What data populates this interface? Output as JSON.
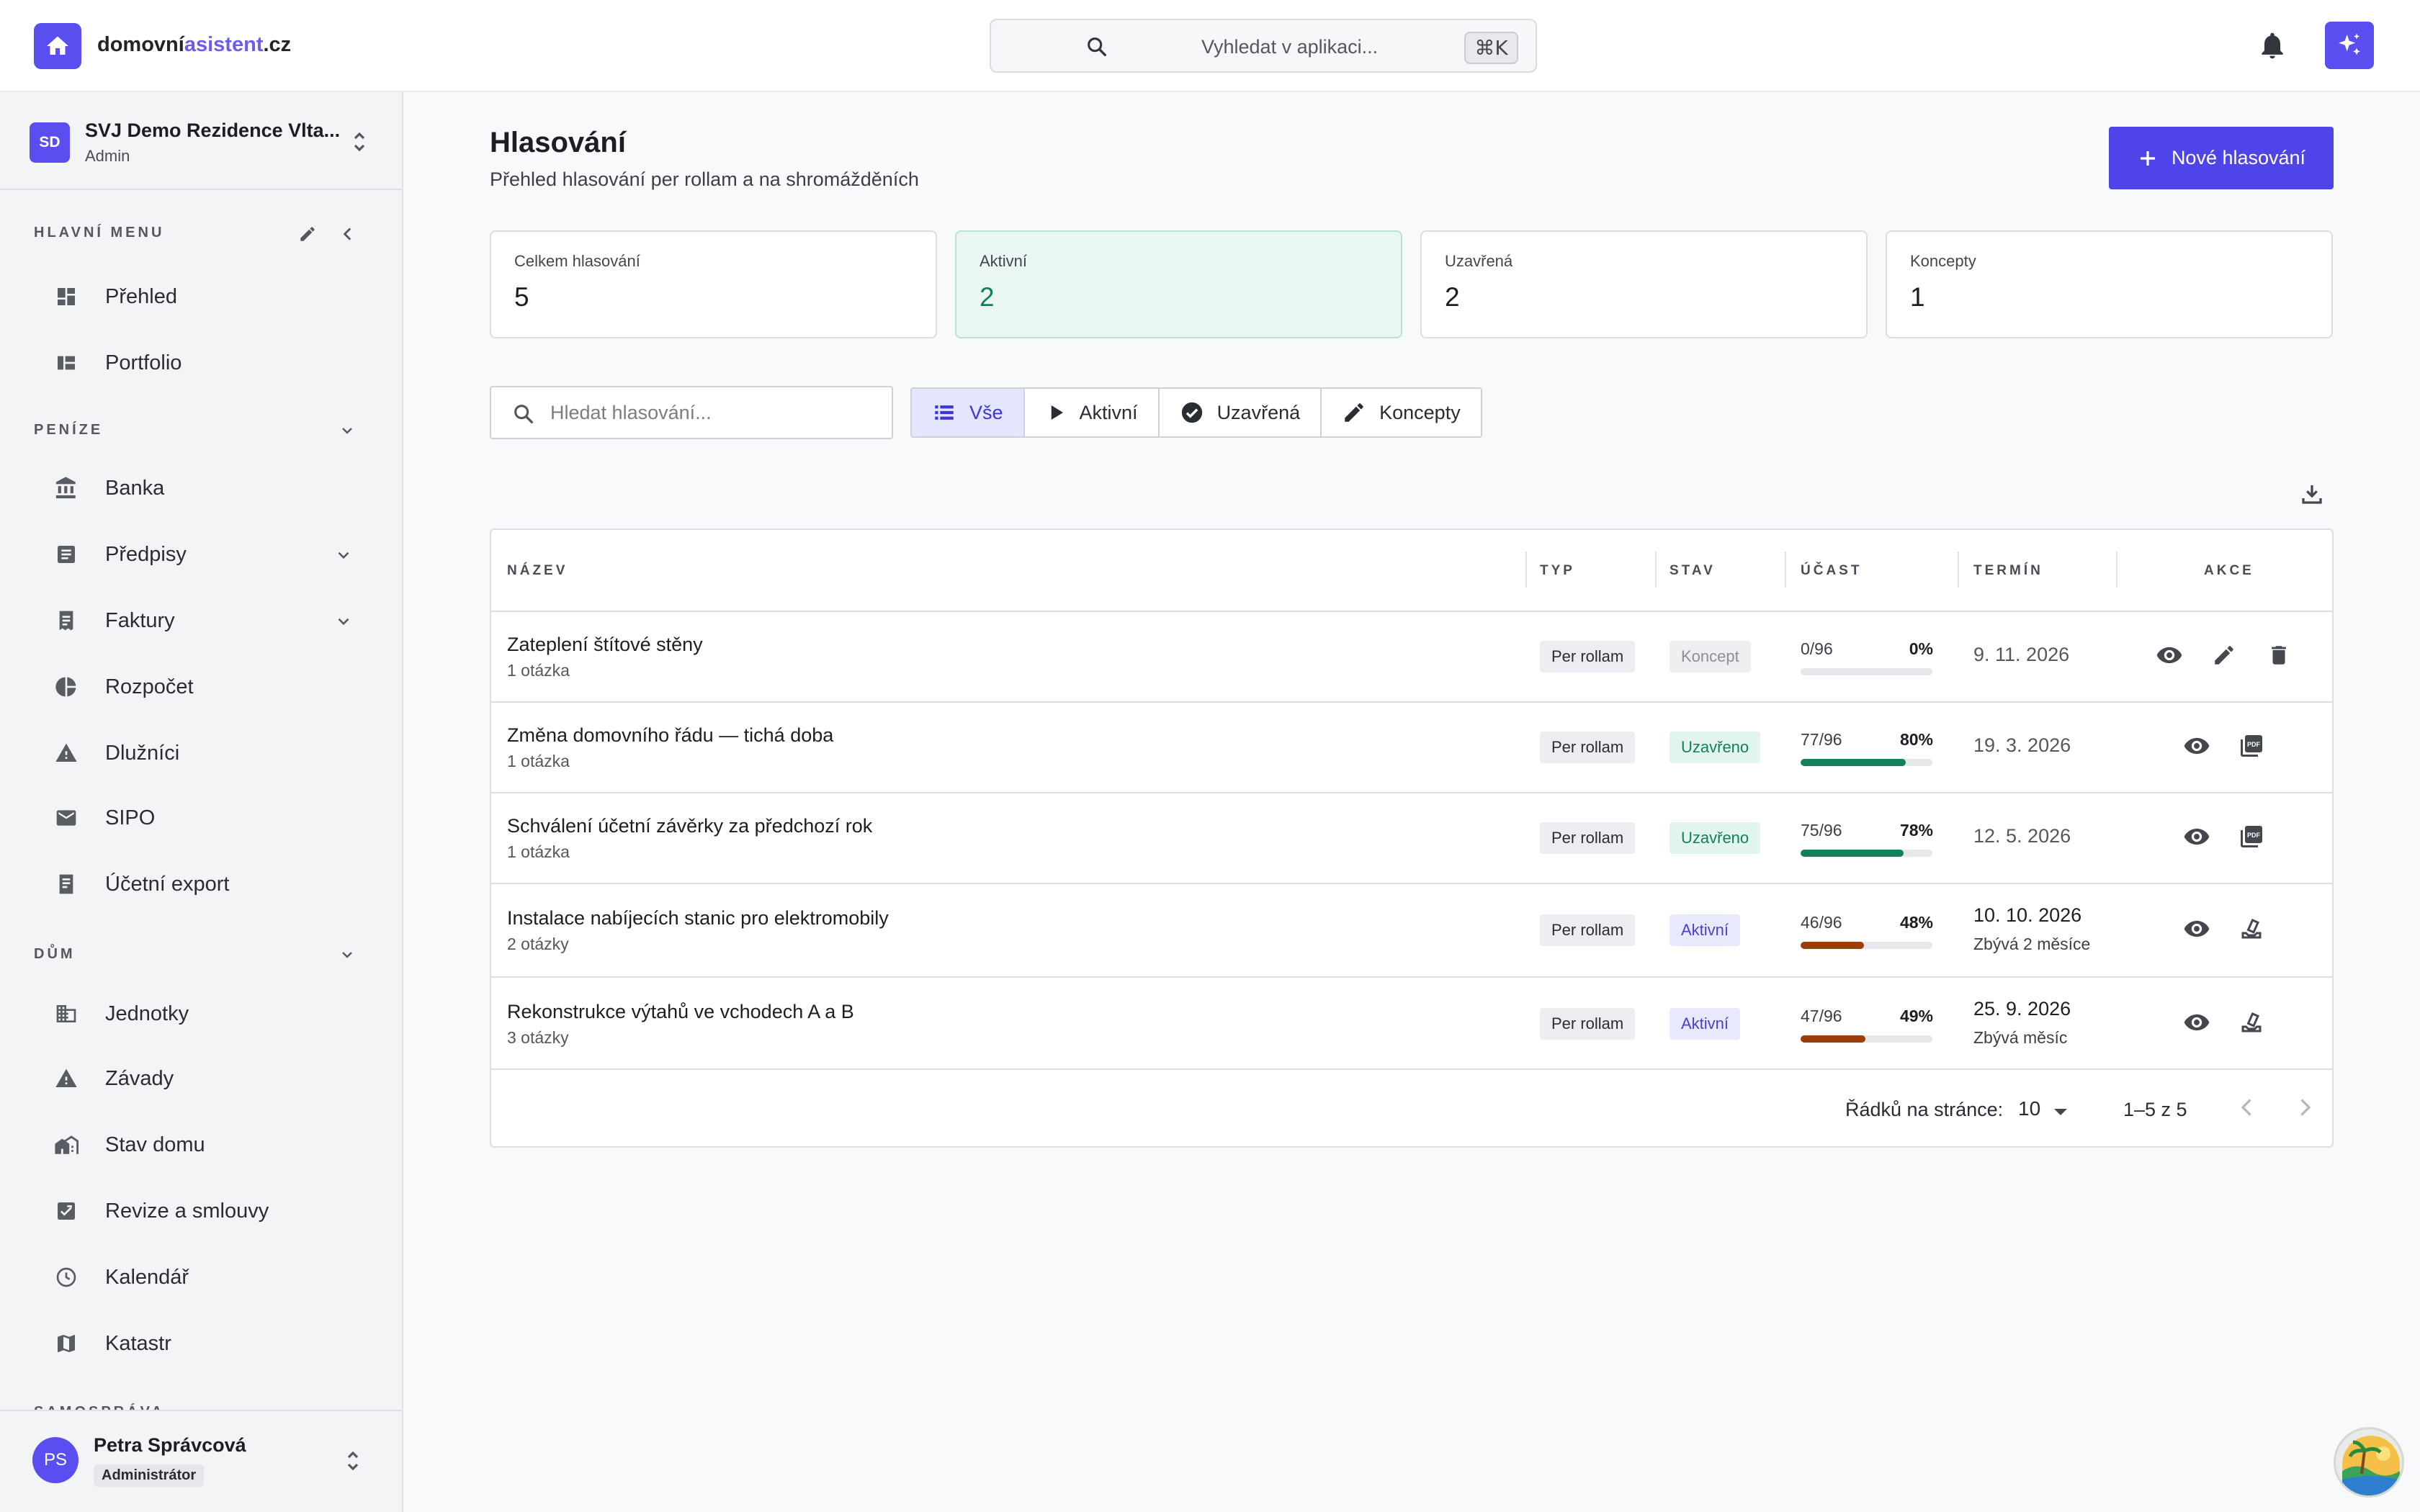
{
  "brand": {
    "prefix": "domovní",
    "accent": "asistent",
    "suffix": ".cz"
  },
  "topbar": {
    "search_placeholder": "Vyhledat v aplikaci...",
    "shortcut": "⌘K"
  },
  "org": {
    "initials": "SD",
    "name": "SVJ Demo Rezidence Vlta...",
    "role": "Admin"
  },
  "sidebar": {
    "main_label": "HLAVNÍ MENU",
    "main_items": [
      {
        "label": "Přehled",
        "icon": "dashboard-icon"
      },
      {
        "label": "Portfolio",
        "icon": "portfolio-icon"
      }
    ],
    "money_label": "PENÍZE",
    "money_items": [
      {
        "label": "Banka",
        "icon": "bank-icon"
      },
      {
        "label": "Předpisy",
        "icon": "prescriptions-icon"
      },
      {
        "label": "Faktury",
        "icon": "invoice-icon"
      },
      {
        "label": "Rozpočet",
        "icon": "pie-chart-icon"
      },
      {
        "label": "Dlužníci",
        "icon": "warning-icon"
      },
      {
        "label": "SIPO",
        "icon": "mail-icon"
      },
      {
        "label": "Účetní export",
        "icon": "export-icon"
      }
    ],
    "house_label": "DŮM",
    "house_items": [
      {
        "label": "Jednotky",
        "icon": "building-icon"
      },
      {
        "label": "Závady",
        "icon": "warning-icon"
      },
      {
        "label": "Stav domu",
        "icon": "house-state-icon"
      },
      {
        "label": "Revize a smlouvy",
        "icon": "checklist-icon"
      },
      {
        "label": "Kalendář",
        "icon": "clock-icon"
      },
      {
        "label": "Katastr",
        "icon": "map-icon"
      }
    ],
    "next_label": "SAMOSPRÁVA"
  },
  "user": {
    "initials": "PS",
    "name": "Petra Správcová",
    "role": "Administrátor"
  },
  "page": {
    "title": "Hlasování",
    "subtitle": "Přehled hlasování per rollam a na shromážděních",
    "new_button": "Nové hlasování"
  },
  "stats": [
    {
      "label": "Celkem hlasování",
      "value": "5"
    },
    {
      "label": "Aktivní",
      "value": "2"
    },
    {
      "label": "Uzavřená",
      "value": "2"
    },
    {
      "label": "Koncepty",
      "value": "1"
    }
  ],
  "filter": {
    "placeholder": "Hledat hlasování...",
    "tabs": [
      "Vše",
      "Aktivní",
      "Uzavřená",
      "Koncepty"
    ],
    "selected": "Vše"
  },
  "table": {
    "headers": [
      "NÁZEV",
      "TYP",
      "STAV",
      "ÚČAST",
      "TERMÍN",
      "AKCE"
    ],
    "rows": [
      {
        "name": "Zateplení štítové stěny",
        "questions": "1 otázka",
        "type": "Per rollam",
        "state": "Koncept",
        "state_kind": "draft",
        "participation": "0/96",
        "pct": "0%",
        "fraction": 0.0,
        "color": "#12805c",
        "term": "9. 11. 2026",
        "term_note": "",
        "actions": [
          "view-icon",
          "edit-icon",
          "delete-icon"
        ]
      },
      {
        "name": "Změna domovního řádu — tichá doba",
        "questions": "1 otázka",
        "type": "Per rollam",
        "state": "Uzavřeno",
        "state_kind": "closed",
        "participation": "77/96",
        "pct": "80%",
        "fraction": 0.8,
        "color": "#12805c",
        "term": "19. 3. 2026",
        "term_note": "",
        "actions": [
          "view-icon",
          "pdf-icon"
        ]
      },
      {
        "name": "Schválení účetní závěrky za předchozí rok",
        "questions": "1 otázka",
        "type": "Per rollam",
        "state": "Uzavřeno",
        "state_kind": "closed",
        "participation": "75/96",
        "pct": "78%",
        "fraction": 0.78,
        "color": "#12805c",
        "term": "12. 5. 2026",
        "term_note": "",
        "actions": [
          "view-icon",
          "pdf-icon"
        ]
      },
      {
        "name": "Instalace nabíjecích stanic pro elektromobily",
        "questions": "2 otázky",
        "type": "Per rollam",
        "state": "Aktivní",
        "state_kind": "active",
        "participation": "46/96",
        "pct": "48%",
        "fraction": 0.48,
        "color": "#9c3d0c",
        "term": "10. 10. 2026",
        "term_note": "Zbývá 2 měsíce",
        "actions": [
          "view-icon",
          "vote-icon"
        ]
      },
      {
        "name": "Rekonstrukce výtahů ve vchodech A a B",
        "questions": "3 otázky",
        "type": "Per rollam",
        "state": "Aktivní",
        "state_kind": "active",
        "participation": "47/96",
        "pct": "49%",
        "fraction": 0.49,
        "color": "#9c3d0c",
        "term": "25. 9. 2026",
        "term_note": "Zbývá měsíc",
        "actions": [
          "view-icon",
          "vote-icon"
        ]
      }
    ],
    "rows_per_page_label": "Řádků na stránce:",
    "rows_per_page": "10",
    "range": "1–5 z 5"
  },
  "colors": {
    "accent": "#5b4ef0",
    "closed": "#12805c",
    "active_bar": "#9c3d0c"
  }
}
